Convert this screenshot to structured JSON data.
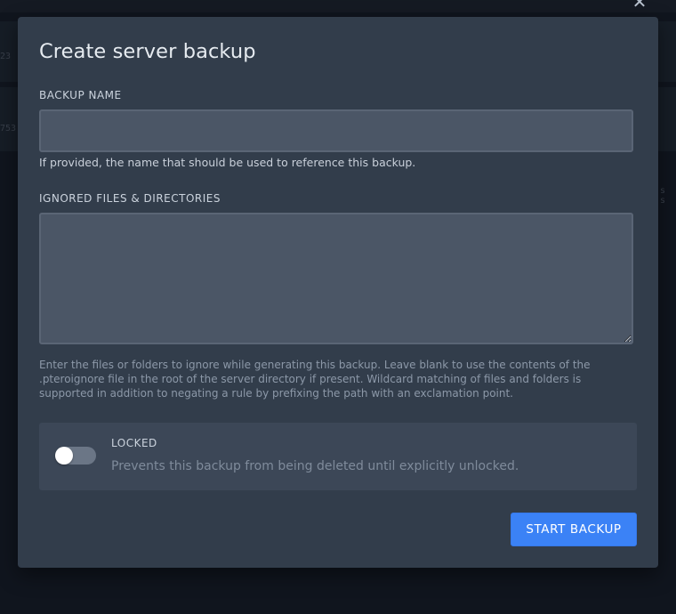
{
  "background": {
    "fragments": [
      "23",
      "753",
      "s s"
    ]
  },
  "modal": {
    "close_icon": "close-icon",
    "title": "Create server backup",
    "backup_name": {
      "label": "BACKUP NAME",
      "value": "",
      "help": "If provided, the name that should be used to reference this backup."
    },
    "ignored": {
      "label": "IGNORED FILES & DIRECTORIES",
      "value": "",
      "help": "Enter the files or folders to ignore while generating this backup. Leave blank to use the contents of the .pteroignore file in the root of the server directory if present. Wildcard matching of files and folders is supported in addition to negating a rule by prefixing the path with an exclamation point."
    },
    "locked": {
      "label": "LOCKED",
      "description": "Prevents this backup from being deleted until explicitly unlocked.",
      "enabled": false
    },
    "start_button": "START BACKUP"
  },
  "colors": {
    "accent": "#3b82f6",
    "modal_bg": "#323d4b",
    "input_bg": "#4b5666"
  }
}
